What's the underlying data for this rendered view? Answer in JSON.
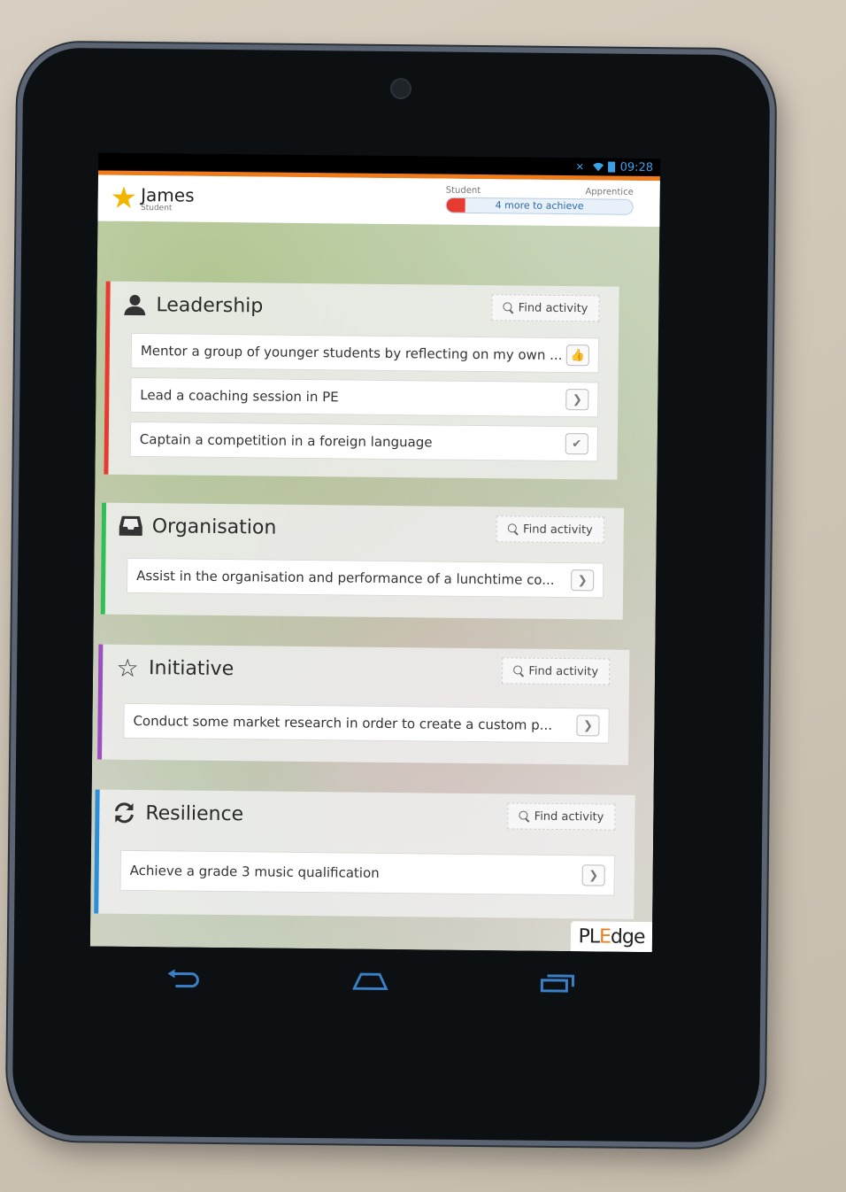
{
  "statusbar": {
    "time": "09:28"
  },
  "header": {
    "user_name": "James",
    "user_level": "Student",
    "progress_from": "Student",
    "progress_to": "Apprentice",
    "progress_text": "4 more to achieve",
    "progress_fraction": 0.1
  },
  "categories": [
    {
      "title": "Leadership",
      "icon": "person-icon",
      "color": "#e63b2e",
      "find_label": "Find activity",
      "activities": [
        {
          "text": "Mentor a group of younger students by reflecting on my own ...",
          "state": "thumbs-up"
        },
        {
          "text": "Lead a coaching session in PE",
          "state": "arrow"
        },
        {
          "text": "Captain a competition in a foreign language",
          "state": "check"
        }
      ]
    },
    {
      "title": "Organisation",
      "icon": "inbox-icon",
      "color": "#2fbf55",
      "find_label": "Find activity",
      "activities": [
        {
          "text": "Assist in the organisation and performance of a lunchtime co...",
          "state": "arrow"
        }
      ]
    },
    {
      "title": "Initiative",
      "icon": "star-outline-icon",
      "color": "#9b4fc0",
      "find_label": "Find activity",
      "activities": [
        {
          "text": "Conduct some market research in order to create a custom p...",
          "state": "arrow"
        }
      ]
    },
    {
      "title": "Resilience",
      "icon": "refresh-icon",
      "color": "#2a8fd8",
      "find_label": "Find activity",
      "activities": [
        {
          "text": "Achieve a grade 3 music qualification",
          "state": "arrow"
        }
      ]
    }
  ],
  "logo": {
    "part1": "PL",
    "part2": "E",
    "part3": "dge"
  }
}
